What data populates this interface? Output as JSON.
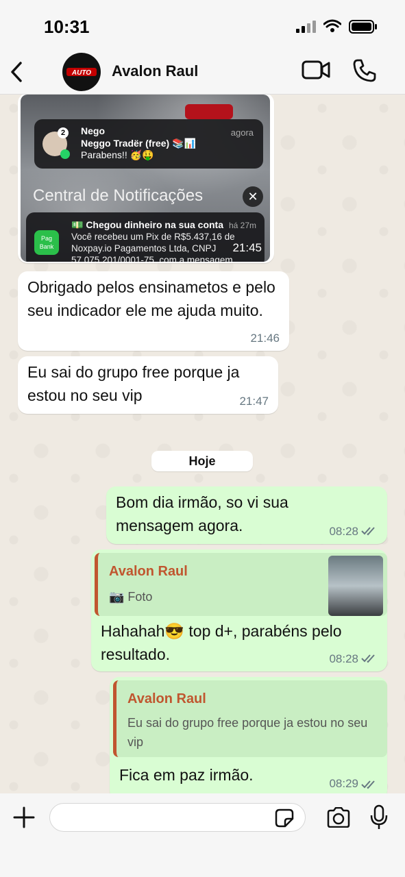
{
  "status_bar": {
    "time": "10:31"
  },
  "header": {
    "contact_name": "Avalon Raul",
    "avatar_brand": "AUTO"
  },
  "messages": {
    "photo": {
      "notification1": {
        "sender": "Nego",
        "group": "Neggo Tradër (free) 📚📊",
        "text": "Parabens!! 🥳🤑",
        "when": "agora",
        "badge": "2"
      },
      "center_title": "Central de Notificações",
      "notification2": {
        "title": "💵 Chegou dinheiro na sua conta",
        "when": "há 27m",
        "body": "Você recebeu um Pix de R$5.437,16 de Noxpay.io Pagamentos Ltda, CNPJ 57.075.201/0001-75, com a mensagem",
        "app_label": "Pag Bank"
      },
      "time": "21:45"
    },
    "in1": {
      "text": "Obrigado pelos ensinametos e pelo seu indicador ele me ajuda muito.",
      "time": "21:46"
    },
    "in2": {
      "text": "Eu sai do grupo free porque ja estou no seu vip",
      "time": "21:47"
    },
    "day_label": "Hoje",
    "out1": {
      "text": "Bom dia irmão, so vi sua mensagem agora.",
      "time": "08:28"
    },
    "out2": {
      "quote_name": "Avalon Raul",
      "quote_text": "📷 Foto",
      "text": "Hahahah😎 top d+, parabéns pelo resultado.",
      "time": "08:28"
    },
    "out3": {
      "quote_name": "Avalon Raul",
      "quote_text": "Eu sai do grupo free porque ja estou no seu vip",
      "text": "Fica em paz irmão.",
      "time": "08:29"
    }
  },
  "composer": {
    "placeholder": ""
  },
  "colors": {
    "outgoing_bubble": "#d9fdd3",
    "incoming_bubble": "#ffffff",
    "quote_accent": "#c0562f",
    "chat_bg": "#efeae2"
  }
}
